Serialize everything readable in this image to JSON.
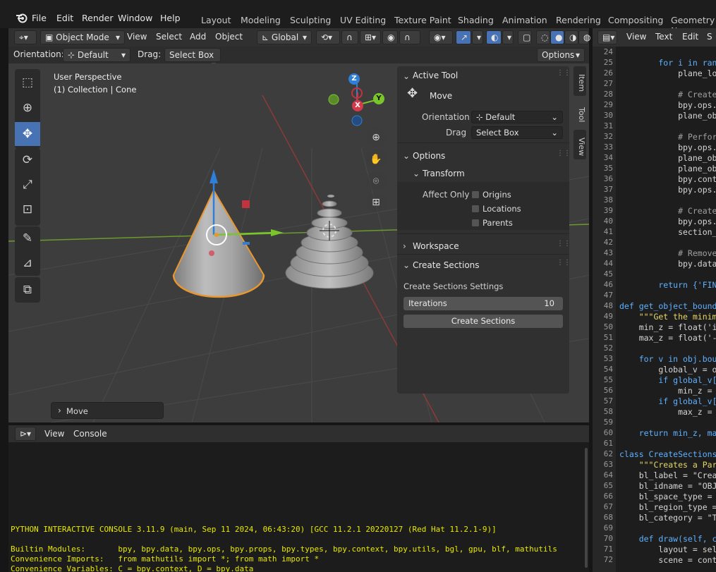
{
  "topbar": {
    "menus": [
      "File",
      "Edit",
      "Render",
      "Window",
      "Help"
    ],
    "workspaces": [
      "Layout",
      "Modeling",
      "Sculpting",
      "UV Editing",
      "Texture Paint",
      "Shading",
      "Animation",
      "Rendering",
      "Compositing",
      "Geometry No"
    ]
  },
  "viewport": {
    "mode": "Object Mode",
    "menus": [
      "View",
      "Select",
      "Add",
      "Object"
    ],
    "transform_orientation": "Global",
    "orientation_label": "Orientation:",
    "orientation_value": "Default",
    "drag_label": "Drag:",
    "drag_value": "Select Box",
    "options_label": "Options",
    "overlay_title": "User Perspective",
    "overlay_subtitle": "(1) Collection | Cone",
    "gizmo_z": "Z",
    "gizmo_y": "Y",
    "gizmo_x": "X",
    "last_op": "Move",
    "side_tabs": [
      "Item",
      "Tool",
      "View"
    ]
  },
  "npanel": {
    "active_tool_title": "Active Tool",
    "tool_name": "Move",
    "orientation_label": "Orientation",
    "orientation_value": "Default",
    "drag_label": "Drag",
    "drag_value": "Select Box",
    "options_title": "Options",
    "transform_title": "Transform",
    "affect_only_label": "Affect Only",
    "affect_origins": "Origins",
    "affect_locations": "Locations",
    "affect_parents": "Parents",
    "workspace_title": "Workspace",
    "create_sections_title": "Create Sections",
    "settings_label": "Create Sections Settings",
    "iterations_label": "Iterations",
    "iterations_value": "10",
    "create_button": "Create Sections"
  },
  "console": {
    "menus": [
      "View",
      "Console"
    ],
    "lines": [
      "PYTHON INTERACTIVE CONSOLE 3.11.9 (main, Sep 11 2024, 06:43:20) [GCC 11.2.1 20220127 (Red Hat 11.2.1-9)]",
      "",
      "Builtin Modules:       bpy, bpy.data, bpy.ops, bpy.props, bpy.types, bpy.context, bpy.utils, bgl, gpu, blf, mathutils",
      "Convenience Imports:   from mathutils import *; from math import *",
      "Convenience Variables: C = bpy.context, D = bpy.data"
    ]
  },
  "texteditor": {
    "menus": [
      "View",
      "Text",
      "Edit",
      "S"
    ],
    "line_numbers": [
      "24",
      "25",
      "26",
      "27",
      "28",
      "29",
      "30",
      "31",
      "32",
      "33",
      "34",
      "35",
      "36",
      "37",
      "38",
      "39",
      "40",
      "41",
      "42",
      "43",
      "44",
      "45",
      "46",
      "47",
      "48",
      "49",
      "50",
      "51",
      "52",
      "53",
      "54",
      "55",
      "56",
      "57",
      "58",
      "59",
      "60",
      "61",
      "62",
      "63",
      "64",
      "65",
      "66",
      "67",
      "68",
      "69",
      "70",
      "71",
      "72"
    ],
    "lines": [
      "",
      "        for i in ran",
      "            plane_lo",
      "",
      "            # Create",
      "            bpy.ops.",
      "            plane_ob",
      "",
      "            # Perfor",
      "            bpy.ops.",
      "            plane_ob",
      "            plane_ob",
      "            bpy.cont",
      "            bpy.ops.",
      "",
      "            # Create",
      "            bpy.ops.",
      "            section_",
      "",
      "            # Remove",
      "            bpy.data",
      "",
      "        return {'FIN",
      "",
      "def get_object_bound",
      "    \"\"\"Get the minim",
      "    min_z = float('i",
      "    max_z = float('-",
      "",
      "    for v in obj.bou",
      "        global_v = o",
      "        if global_v[",
      "            min_z = ",
      "        if global_v[",
      "            max_z = ",
      "",
      "    return min_z, ma",
      "",
      "class CreateSections",
      "    \"\"\"Creates a Par",
      "    bl_label = \"Crea",
      "    bl_idname = \"OBJ",
      "    bl_space_type = ",
      "    bl_region_type =",
      "    bl_category = \"T",
      "",
      "    def draw(self, c",
      "        layout = sel",
      "        scene = cont"
    ]
  },
  "colors": {
    "accent": "#4772b3",
    "selected_outline": "#e8962f",
    "console_text": "#e8e800",
    "axis_x": "#d33a4a",
    "axis_y": "#7ac52c",
    "axis_z": "#2f7fd6"
  }
}
